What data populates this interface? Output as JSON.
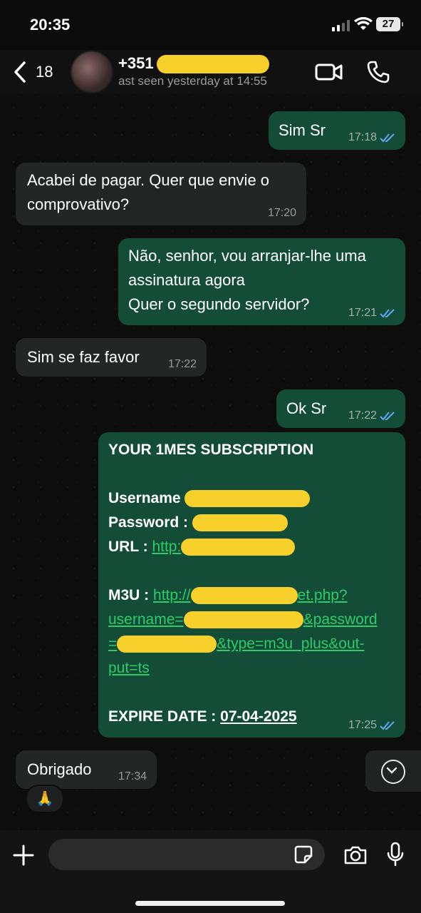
{
  "status_bar": {
    "time": "20:35",
    "battery": "27"
  },
  "header": {
    "back_count": "18",
    "contact_name": "+351",
    "last_seen": "ast seen yesterday at 14:55"
  },
  "messages": [
    {
      "dir": "out",
      "text": "Sim Sr",
      "time": "17:18"
    },
    {
      "dir": "in",
      "lines": [
        "Acabei de pagar. Quer que envie o",
        "comprovativo?"
      ],
      "time": "17:20"
    },
    {
      "dir": "out",
      "lines": [
        "Não, senhor, vou arranjar-lhe uma",
        "assinatura agora",
        "Quer o segundo servidor?"
      ],
      "time": "17:21"
    },
    {
      "dir": "in",
      "text": "Sim se faz favor",
      "time": "17:22"
    },
    {
      "dir": "out",
      "text": "Ok Sr",
      "time": "17:22"
    },
    {
      "dir": "out",
      "subscription": {
        "title": "YOUR 1MES SUBSCRIPTION",
        "username_label": "Username",
        "password_label": "Password :",
        "url_label": "URL :",
        "url_prefix": "http:",
        "m3u_label": "M3U :",
        "m3u_prefix": "http://",
        "m3u_suffix": "et.php?",
        "m3u_line2_a": "username=",
        "m3u_line2_b": "&password",
        "m3u_line3_a": "=",
        "m3u_line3_b": "&type=m3u_plus&out-",
        "m3u_line4": "put=ts",
        "expire_label": "EXPIRE DATE :",
        "expire_date": "07-04-2025"
      },
      "time": "17:25"
    },
    {
      "dir": "in",
      "text": "Obrigado",
      "time": "17:34",
      "reaction": "🙏"
    }
  ],
  "icons": {
    "back": "chevron-left-icon",
    "video": "video-camera-icon",
    "call": "phone-icon",
    "read": "double-check-icon",
    "scroll": "chevron-down-circle-icon",
    "plus": "plus-icon",
    "sticker": "sticker-icon",
    "camera": "camera-icon",
    "mic": "microphone-icon"
  },
  "colors": {
    "outgoing_bubble": "#134d37",
    "incoming_bubble": "#242626",
    "link": "#2ecb68",
    "read_tick": "#5aa9f5",
    "redaction": "#f7d02c"
  }
}
